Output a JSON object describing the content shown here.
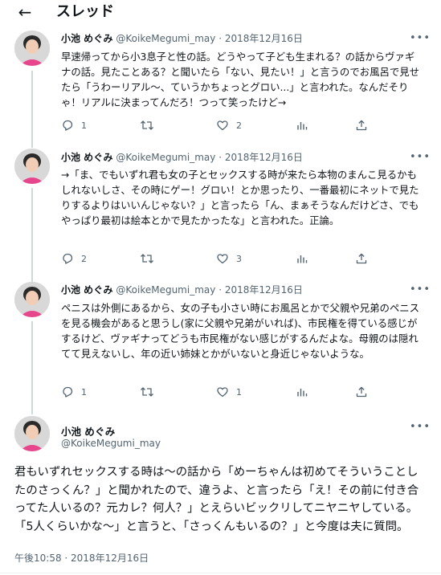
{
  "header": {
    "back_icon": "arrow-left-icon",
    "title": "スレッド"
  },
  "author": {
    "name": "小池 めぐみ",
    "handle": "@KoikeMegumi_may"
  },
  "tweets": [
    {
      "separator": "·",
      "date": "2018年12月16日",
      "text": "早速帰ってから小3息子と性の話。どうやって子ども生まれる？の話からヴァギナの話。見たことある？と聞いたら「ない、見たい！」と言うのでお風呂で見せたら「うわーリアル〜、ていうかちょっとグロい...」と言われた。なんだそりゃ！リアルに決まってんだろ！つって笑ったけど→",
      "reply_count": "1",
      "retweet_count": "",
      "like_count": "2"
    },
    {
      "separator": "·",
      "date": "2018年12月16日",
      "text": "→「ま、でもいずれ君も女の子とセックスする時が来たら本物のまんこ見るかもしれないしさ、その時にゲー！グロい！とか思ったり、一番最初にネットで見たりするよりはいいんじゃない？」と言ったら「ん、まぁそうなんだけどさ、でもやっぱり最初は絵本とかで見たかったな」と言われた。正論。",
      "reply_count": "2",
      "retweet_count": "",
      "like_count": "3"
    },
    {
      "separator": "·",
      "date": "2018年12月16日",
      "text": "ペニスは外側にあるから、女の子も小さい時にお風呂とかで父親や兄弟のペニスを見る機会があると思うし(家に父親や兄弟がいれば)、市民権を得ている感じがするけど、ヴァギナってどうも市民権がない感じがするんだよな。母親のは隠れてて見えないし、年の近い姉妹とかがいないと身近じゃないような。",
      "reply_count": "1",
      "retweet_count": "",
      "like_count": "1"
    }
  ],
  "main_tweet": {
    "text": "君もいずれセックスする時は〜の話から「めーちゃんは初めてそういうことしたのさっくん？」と聞かれたので、違うよ、と言ったら「え！その前に付き合ってた人いるの？元カレ？何人？」とえらいビックリしてニヤニヤしている。「5人くらいかな〜」と言うと、「さっくんもいるの？」と今度は夫に質問。",
    "time": "午後10:58 · 2018年12月16日"
  },
  "icons": {
    "more": "more-icon",
    "reply": "reply-icon",
    "retweet": "retweet-icon",
    "like": "heart-icon",
    "analytics": "analytics-icon",
    "share": "share-icon"
  },
  "colors": {
    "text": "#0f1419",
    "secondary": "#536471",
    "thread_line": "#cfd9de",
    "avatar_accent": "#e7458c"
  }
}
